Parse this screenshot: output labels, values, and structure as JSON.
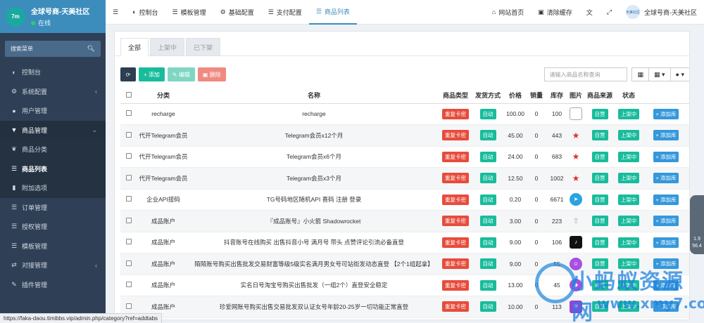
{
  "brand": {
    "logo_text": "7m",
    "site_name": "全球号商-天美社区",
    "status": "在线"
  },
  "sidebar": {
    "search_placeholder": "搜索菜单",
    "items": [
      {
        "label": "控制台",
        "icon": "dashboard-icon"
      },
      {
        "label": "系统配置",
        "icon": "gear-icon",
        "caret": "‹"
      },
      {
        "label": "用户管理",
        "icon": "user-icon"
      },
      {
        "label": "商品管理",
        "icon": "cart-icon",
        "caret": "⌄"
      },
      {
        "label": "商品分类",
        "icon": "leaf-icon"
      },
      {
        "label": "商品列表",
        "icon": "list-icon"
      },
      {
        "label": "附加选项",
        "icon": "bookmark-icon"
      },
      {
        "label": "订单管理",
        "icon": "list-icon"
      },
      {
        "label": "授权管理",
        "icon": "list-icon"
      },
      {
        "label": "模板管理",
        "icon": "list-icon"
      },
      {
        "label": "对接管理",
        "icon": "link-icon",
        "caret": "‹"
      },
      {
        "label": "插件管理",
        "icon": "plugin-icon"
      }
    ]
  },
  "topbar": {
    "tabs": [
      {
        "label": "控制台",
        "icon": "dashboard-icon"
      },
      {
        "label": "模板管理",
        "icon": "list-icon"
      },
      {
        "label": "基础配置",
        "icon": "gear-icon"
      },
      {
        "label": "支付配置",
        "icon": "list-icon"
      },
      {
        "label": "商品列表",
        "icon": "list-icon"
      }
    ],
    "home_label": "网站首页",
    "cache_label": "清除缓存",
    "avatar_text": "天美社区",
    "user_name": "全球号商-天美社区"
  },
  "content": {
    "tabs": [
      "全部",
      "上架中",
      "已下架"
    ],
    "toolbar": {
      "add": "添加",
      "edit": "编辑",
      "delete": "删除",
      "search_placeholder": "请输入商品名称查询"
    },
    "columns": [
      "分类",
      "名称",
      "商品类型",
      "发货方式",
      "价格",
      "销量",
      "库存",
      "图片",
      "商品来源",
      "状态"
    ],
    "action_label": "添加库",
    "rows": [
      {
        "category": "recharge",
        "name": "recharge",
        "type": "重复卡密",
        "delivery": "自动",
        "price": "100.00",
        "sales": "0",
        "stock": "100",
        "img": "broken-image-icon",
        "source": "自营",
        "status": "上架中"
      },
      {
        "category": "代开Telegram会员",
        "name": "Telegram会员x12个月",
        "type": "重复卡密",
        "delivery": "自动",
        "price": "45.00",
        "sales": "0",
        "stock": "443",
        "img": "star-icon",
        "source": "自营",
        "status": "上架中"
      },
      {
        "category": "代开Telegram会员",
        "name": "Telegram会员x6个月",
        "type": "重复卡密",
        "delivery": "自动",
        "price": "24.00",
        "sales": "0",
        "stock": "683",
        "img": "star-icon",
        "source": "自营",
        "status": "上架中"
      },
      {
        "category": "代开Telegram会员",
        "name": "Telegram会员x3个月",
        "type": "重复卡密",
        "delivery": "自动",
        "price": "12.50",
        "sales": "0",
        "stock": "1002",
        "img": "star-icon",
        "source": "自营",
        "status": "上架中"
      },
      {
        "category": "企业API接码",
        "name": "TG号码地区随机API 喜码 注册 登录",
        "type": "重复卡密",
        "delivery": "自动",
        "price": "0.20",
        "sales": "0",
        "stock": "6671",
        "img": "telegram-icon",
        "source": "自营",
        "status": "上架中"
      },
      {
        "category": "成品账户",
        "name": "『成品账号』小火箭 Shadowrocket",
        "type": "重复卡密",
        "delivery": "自动",
        "price": "3.00",
        "sales": "0",
        "stock": "223",
        "img": "rocket-icon",
        "source": "自营",
        "status": "上架中"
      },
      {
        "category": "成品账户",
        "name": "抖音账号在线购买 出售抖音小号 满月号 带头 点赞评论引流必备直登",
        "type": "重复卡密",
        "delivery": "自动",
        "price": "9.00",
        "sales": "0",
        "stock": "106",
        "img": "tiktok-icon",
        "source": "自营",
        "status": "上架中"
      },
      {
        "category": "成品账户",
        "name": "陌陌账号购买出售批发交易财富等级5级实名满月男女号可站街发动态直登 【2个1组起拿】",
        "type": "重复卡密",
        "delivery": "自动",
        "price": "9.00",
        "sales": "0",
        "stock": "55",
        "img": "momo-icon",
        "source": "自营",
        "status": "上架中"
      },
      {
        "category": "成品账户",
        "name": "实名日号淘宝号购买出售批发（一组2个）直登安全稳定",
        "type": "重复卡密",
        "delivery": "自动",
        "price": "13.00",
        "sales": "0",
        "stock": "45",
        "img": "shield-icon",
        "source": "自营",
        "status": "上架中"
      },
      {
        "category": "成品账户",
        "name": "珍爱网账号购买出售交易批发双认证女号年龄20-25岁一切功能正常直登",
        "type": "重复卡密",
        "delivery": "自动",
        "price": "10.00",
        "sales": "0",
        "stock": "113",
        "img": "zhenai-icon",
        "source": "自营",
        "status": "上架中"
      }
    ]
  },
  "statusbar": {
    "url": "https://faka-daou.timibbs.vip/admin.php/category?ref=addtabs"
  },
  "sidewidget": {
    "line1": "1.9",
    "line2": "56.4"
  },
  "watermark": {
    "title": "小蚂蚁资源网",
    "url": "www.xmy7.com"
  }
}
